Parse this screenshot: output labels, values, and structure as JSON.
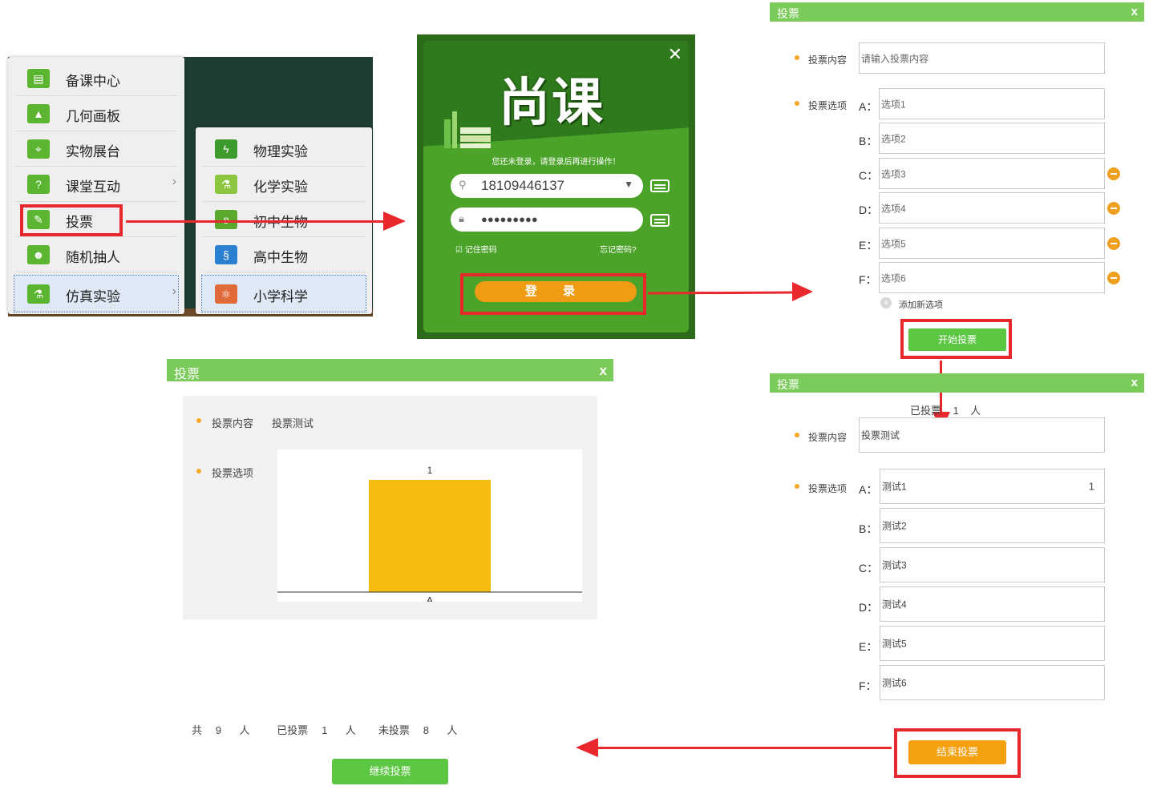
{
  "menu_main": {
    "items": [
      {
        "label": "备课中心",
        "icon": "book-icon"
      },
      {
        "label": "几何画板",
        "icon": "geometry-icon"
      },
      {
        "label": "实物展台",
        "icon": "projector-icon"
      },
      {
        "label": "课堂互动",
        "icon": "interact-icon"
      },
      {
        "label": "投票",
        "icon": "vote-icon"
      },
      {
        "label": "随机抽人",
        "icon": "people-icon"
      },
      {
        "label": "仿真实验",
        "icon": "lab-icon"
      }
    ]
  },
  "menu_sub": {
    "items": [
      {
        "label": "物理实验",
        "icon": "lightning-icon"
      },
      {
        "label": "化学实验",
        "icon": "flask-icon"
      },
      {
        "label": "初中生物",
        "icon": "butterfly-icon"
      },
      {
        "label": "高中生物",
        "icon": "dna-icon"
      },
      {
        "label": "小学科学",
        "icon": "atom-icon"
      }
    ]
  },
  "login": {
    "logo": "尚课",
    "message": "您还未登录，请登录后再进行操作！",
    "username": "18109446137",
    "password_mask": "●●●●●●●●●",
    "remember": "记住密码",
    "forgot": "忘记密码?",
    "submit": "登 录",
    "close": "✕"
  },
  "vote_create": {
    "title": "投票",
    "close": "x",
    "content_label": "投票内容",
    "content_placeholder": "请输入投票内容",
    "options_label": "投票选项",
    "options": [
      {
        "letter": "A：",
        "placeholder": "选项1",
        "removable": false
      },
      {
        "letter": "B：",
        "placeholder": "选项2",
        "removable": false
      },
      {
        "letter": "C：",
        "placeholder": "选项3",
        "removable": true
      },
      {
        "letter": "D：",
        "placeholder": "选项4",
        "removable": true
      },
      {
        "letter": "E：",
        "placeholder": "选项5",
        "removable": true
      },
      {
        "letter": "F：",
        "placeholder": "选项6",
        "removable": true
      }
    ],
    "add_option": "添加新选项",
    "start": "开始投票"
  },
  "vote_progress": {
    "title": "投票",
    "close": "x",
    "voted_label": "已投票",
    "voted_count": "1",
    "unit": "人",
    "content_label": "投票内容",
    "content_value": "投票测试",
    "options_label": "投票选项",
    "options": [
      {
        "letter": "A：",
        "value": "测试1",
        "count": "1"
      },
      {
        "letter": "B：",
        "value": "测试2",
        "count": ""
      },
      {
        "letter": "C：",
        "value": "测试3",
        "count": ""
      },
      {
        "letter": "D：",
        "value": "测试4",
        "count": ""
      },
      {
        "letter": "E：",
        "value": "测试5",
        "count": ""
      },
      {
        "letter": "F：",
        "value": "测试6",
        "count": ""
      }
    ],
    "end": "结束投票"
  },
  "vote_result": {
    "title": "投票",
    "close": "x",
    "content_label": "投票内容",
    "content_value": "投票测试",
    "options_label": "投票选项",
    "summary": {
      "total_label": "共",
      "total": "9",
      "voted_label": "已投票",
      "voted": "1",
      "unvoted_label": "未投票",
      "unvoted": "8",
      "unit": "人"
    },
    "continue": "继续投票"
  },
  "chart_data": {
    "type": "bar",
    "categories": [
      "A"
    ],
    "values": [
      1
    ],
    "data_labels": [
      "1"
    ],
    "ylim": [
      0,
      1.2
    ],
    "color": "#f5bb0e"
  },
  "colors": {
    "accent_red": "#e8282d",
    "green_title": "#7bcb5a",
    "orange": "#f4a00f",
    "login_green": "#4ca32a"
  }
}
